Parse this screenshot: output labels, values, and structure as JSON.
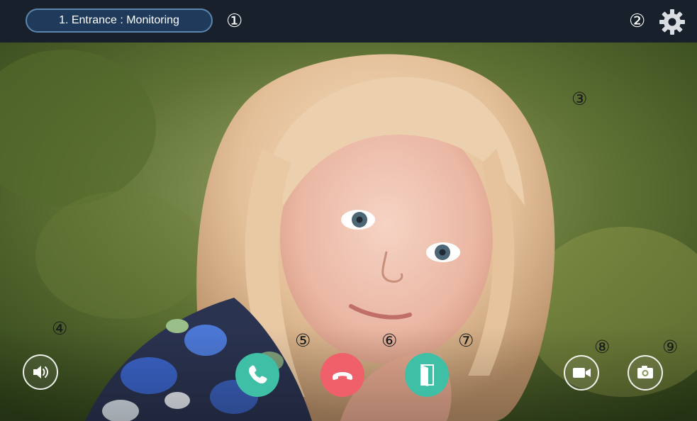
{
  "header": {
    "title": "1. Entrance : Monitoring"
  },
  "callouts": {
    "c1": "①",
    "c2": "②",
    "c3": "③",
    "c4": "④",
    "c5": "⑤",
    "c6": "⑥",
    "c7": "⑦",
    "c8": "⑧",
    "c9": "⑨"
  },
  "icons": {
    "settings": "gear-icon",
    "speaker": "speaker-volume-icon",
    "answer": "phone-answer-icon",
    "hangup": "phone-hangup-icon",
    "door": "door-open-icon",
    "record": "video-camera-icon",
    "snapshot": "camera-icon"
  },
  "colors": {
    "topbar": "#18202b",
    "pill_border": "#5b86ad",
    "pill_fill": "#1f3a5a",
    "answer_green": "#3ebfa6",
    "hangup_red": "#f0606b",
    "door_green": "#3ebfa6"
  }
}
